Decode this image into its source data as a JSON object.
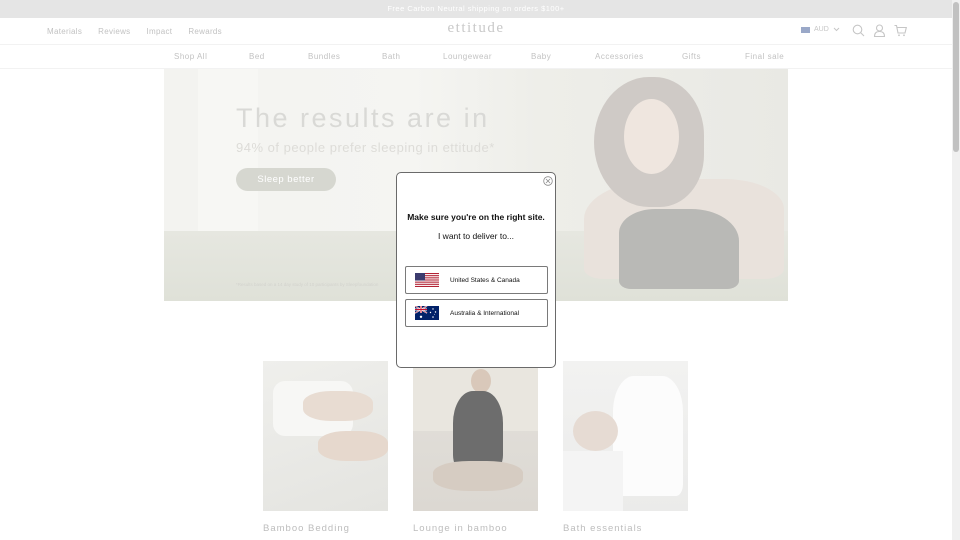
{
  "announcement": "Free Carbon Neutral shipping on orders $100+",
  "header": {
    "util_links": [
      "Materials",
      "Reviews",
      "Impact",
      "Rewards"
    ],
    "logo": "ettitude",
    "currency": "AUD",
    "icons": [
      "search-icon",
      "account-icon",
      "cart-icon"
    ]
  },
  "categories": [
    "Shop All",
    "Bed",
    "Bundles",
    "Bath",
    "Loungewear",
    "Baby",
    "Accessories",
    "Gifts",
    "Final sale"
  ],
  "hero": {
    "title": "The results are in",
    "subtitle": "94% of people prefer sleeping in ettitude*",
    "cta": "Sleep better",
    "footnote": "*Results based on a 14 day study of 10 participants by Sleepfoundation"
  },
  "cards": [
    "Bamboo Bedding",
    "Lounge in bamboo",
    "Bath essentials"
  ],
  "modal": {
    "title": "Make sure you're on the right site.",
    "subtitle": "I want to deliver to...",
    "options": [
      {
        "label": "United States & Canada",
        "flag": "us-flag-icon"
      },
      {
        "label": "Australia & International",
        "flag": "au-flag-icon"
      }
    ]
  },
  "colors": {
    "announcement_bg": "#e5e5e5",
    "modal_border": "#6a6a6a",
    "modal_text": "#111111"
  }
}
